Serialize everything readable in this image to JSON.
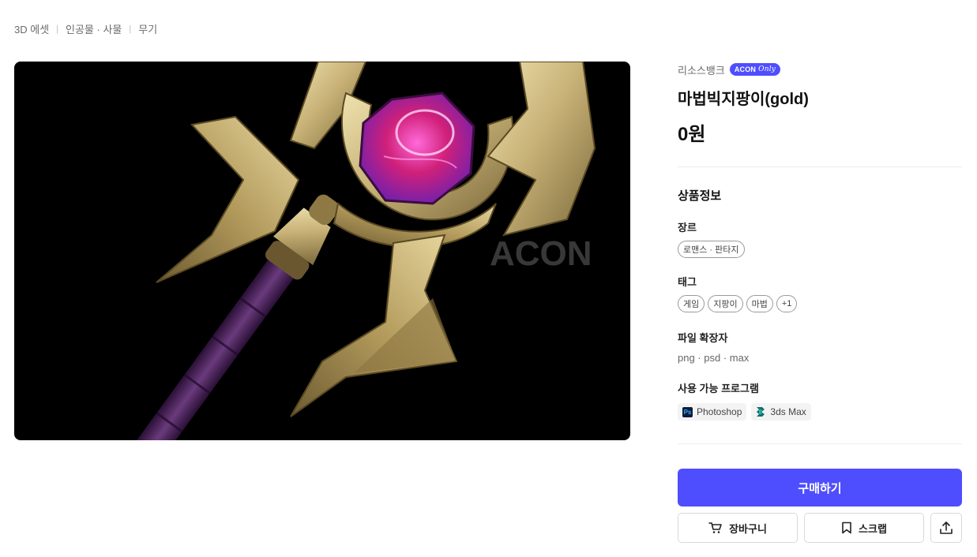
{
  "breadcrumb": [
    "3D 에셋",
    "인공물 · 사물",
    "무기"
  ],
  "hero": {
    "watermark": "ACON"
  },
  "product": {
    "seller": "리소스뱅크",
    "badge": {
      "brand": "ACON",
      "suffix": "Only"
    },
    "title": "마법빅지팡이(gold)",
    "price": "0원"
  },
  "info": {
    "section_title": "상품정보",
    "genre_label": "장르",
    "genre": [
      "로맨스 · 판타지"
    ],
    "tags_label": "태그",
    "tags": [
      "게임",
      "지팡이",
      "마법",
      "+1"
    ],
    "ext_label": "파일 확장자",
    "extensions": "png · psd · max",
    "programs_label": "사용 가능 프로그램",
    "programs": [
      {
        "name": "Photoshop",
        "icon": "photoshop-icon",
        "icon_text": "Ps"
      },
      {
        "name": "3ds Max",
        "icon": "3dsmax-icon"
      }
    ]
  },
  "actions": {
    "buy": "구매하기",
    "cart": "장바구니",
    "scrap": "스크랩"
  },
  "colors": {
    "accent": "#4e4eff"
  }
}
